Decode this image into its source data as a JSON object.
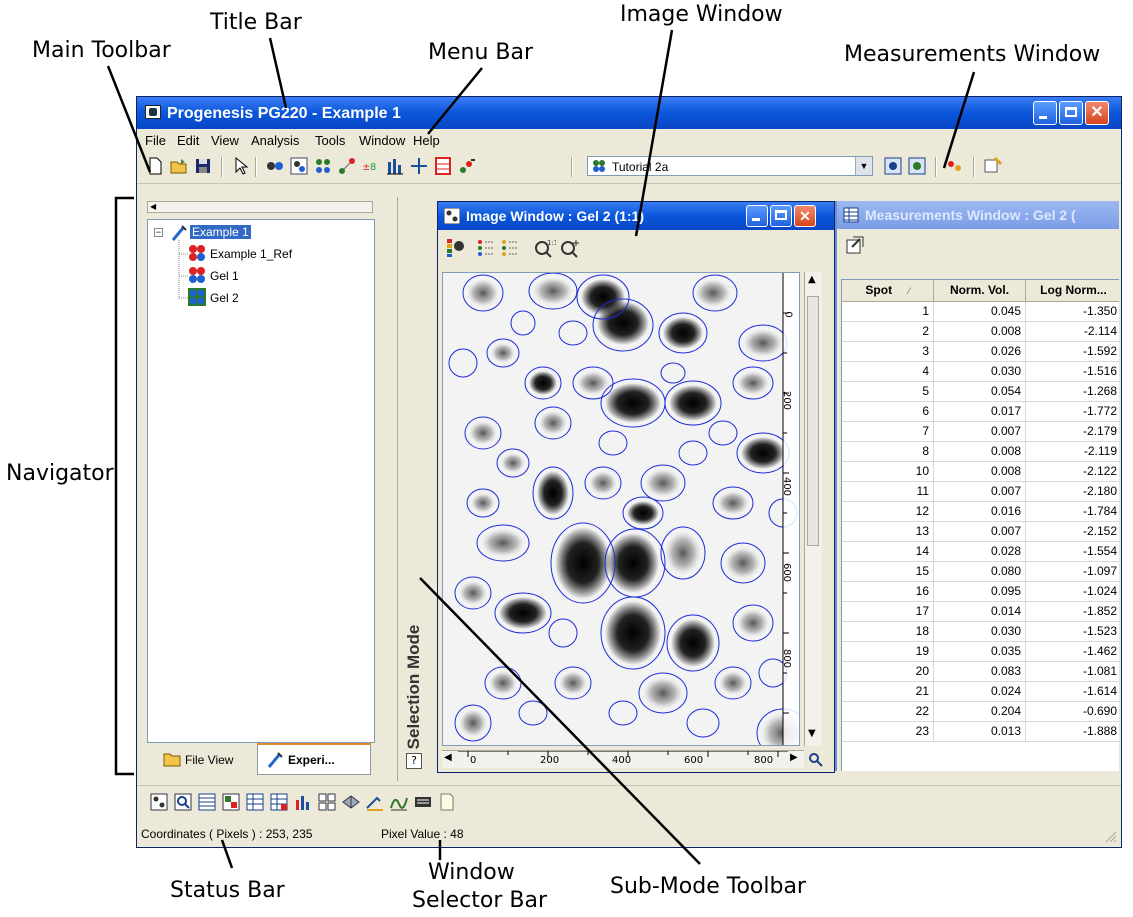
{
  "annotations": {
    "title_bar": "Title Bar",
    "main_toolbar": "Main Toolbar",
    "menu_bar": "Menu Bar",
    "image_window": "Image Window",
    "measurements_window": "Measurements Window",
    "navigator": "Navigator",
    "status_bar": "Status Bar",
    "window_selector_bar_1": "Window",
    "window_selector_bar_2": "Selector Bar",
    "sub_mode_toolbar": "Sub-Mode Toolbar"
  },
  "window": {
    "title": "Progenesis PG220 - Example 1"
  },
  "menu": [
    "File",
    "Edit",
    "View",
    "Analysis",
    "Tools",
    "Window",
    "Help"
  ],
  "toolbar": {
    "experiment_combo": "Tutorial 2a"
  },
  "navigator": {
    "tree": {
      "root": "Example 1",
      "children": [
        "Example 1_Ref",
        "Gel 1",
        "Gel 2"
      ]
    },
    "tabs": {
      "file_view": "File View",
      "experiment": "Experi..."
    }
  },
  "sub_mode": {
    "label": "Selection Mode"
  },
  "image_window": {
    "title": "Image Window : Gel 2 (1:1)",
    "y_ticks": [
      "0",
      "200",
      "400",
      "600",
      "800"
    ],
    "x_ticks": [
      "0",
      "200",
      "400",
      "600",
      "800"
    ]
  },
  "measurements_window": {
    "title": "Measurements Window : Gel 2 (",
    "columns": [
      "Spot",
      "Norm. Vol.",
      "Log Norm..."
    ],
    "rows": [
      [
        "1",
        "0.045",
        "-1.350"
      ],
      [
        "2",
        "0.008",
        "-2.114"
      ],
      [
        "3",
        "0.026",
        "-1.592"
      ],
      [
        "4",
        "0.030",
        "-1.516"
      ],
      [
        "5",
        "0.054",
        "-1.268"
      ],
      [
        "6",
        "0.017",
        "-1.772"
      ],
      [
        "7",
        "0.007",
        "-2.179"
      ],
      [
        "8",
        "0.008",
        "-2.119"
      ],
      [
        "10",
        "0.008",
        "-2.122"
      ],
      [
        "11",
        "0.007",
        "-2.180"
      ],
      [
        "12",
        "0.016",
        "-1.784"
      ],
      [
        "13",
        "0.007",
        "-2.152"
      ],
      [
        "14",
        "0.028",
        "-1.554"
      ],
      [
        "15",
        "0.080",
        "-1.097"
      ],
      [
        "16",
        "0.095",
        "-1.024"
      ],
      [
        "17",
        "0.014",
        "-1.852"
      ],
      [
        "18",
        "0.030",
        "-1.523"
      ],
      [
        "19",
        "0.035",
        "-1.462"
      ],
      [
        "20",
        "0.083",
        "-1.081"
      ],
      [
        "21",
        "0.024",
        "-1.614"
      ],
      [
        "22",
        "0.204",
        "-0.690"
      ],
      [
        "23",
        "0.013",
        "-1.888"
      ]
    ]
  },
  "status": {
    "coordinates": "Coordinates ( Pixels ) : 253, 235",
    "pixel_value": "Pixel Value : 48"
  }
}
